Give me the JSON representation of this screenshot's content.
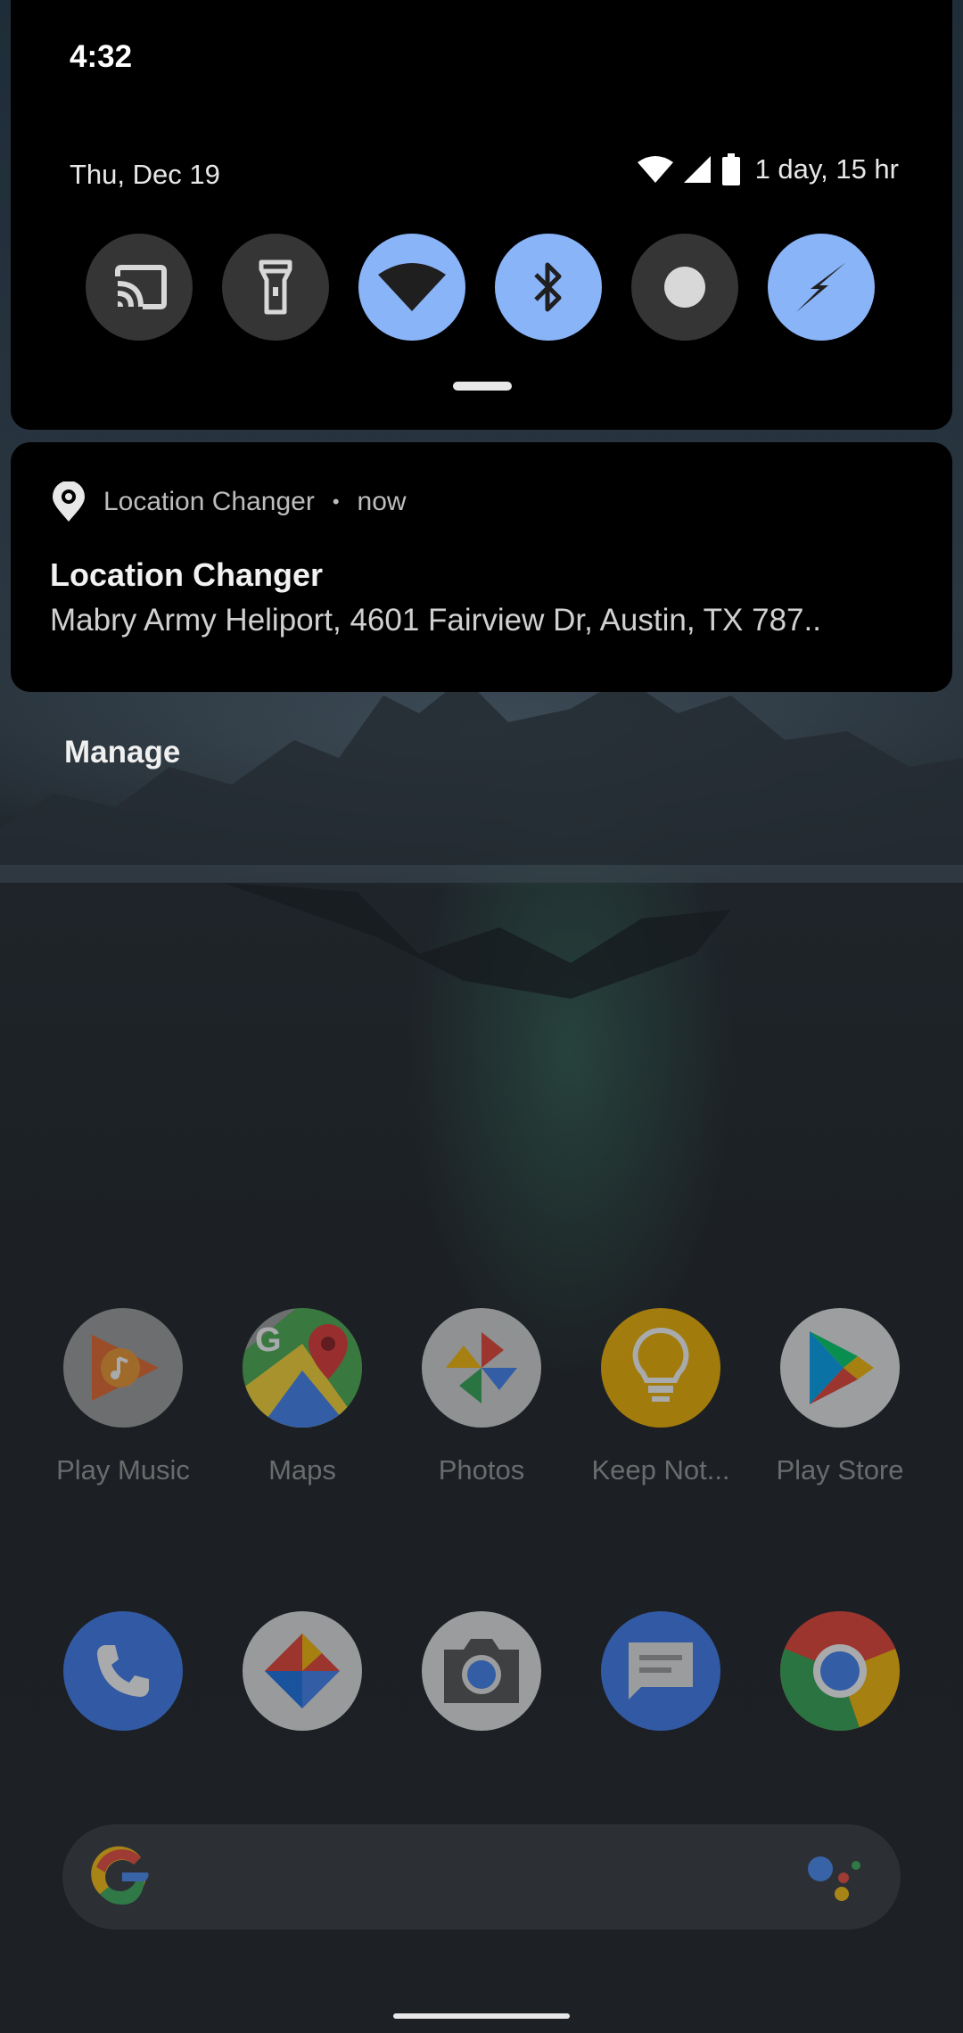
{
  "status_bar": {
    "time": "4:32",
    "date": "Thu, Dec 19",
    "battery_text": "1 day, 15 hr",
    "icons": [
      "wifi-icon",
      "cellular-signal-icon",
      "battery-icon"
    ]
  },
  "quick_settings": {
    "tiles": [
      {
        "name": "cast",
        "icon": "cast-icon",
        "active": false
      },
      {
        "name": "flashlight",
        "icon": "flashlight-icon",
        "active": false
      },
      {
        "name": "wifi",
        "icon": "wifi-icon",
        "active": true
      },
      {
        "name": "bluetooth",
        "icon": "bluetooth-icon",
        "active": true
      },
      {
        "name": "do-not-disturb",
        "icon": "dot-icon",
        "active": false
      },
      {
        "name": "battery-saver",
        "icon": "bolt-icon",
        "active": true
      }
    ],
    "colors": {
      "active": "#8ab4f8",
      "inactive": "#353535"
    }
  },
  "notification": {
    "app_name": "Location Changer",
    "separator": "•",
    "time": "now",
    "title": "Location Changer",
    "text": "Mabry Army Heliport, 4601 Fairview Dr, Austin, TX 787..",
    "icon": "location-gear-icon"
  },
  "manage_label": "Manage",
  "home": {
    "apps_row": [
      {
        "label": "Play Music",
        "icon": "play-music-icon"
      },
      {
        "label": "Maps",
        "icon": "maps-icon"
      },
      {
        "label": "Photos",
        "icon": "photos-icon"
      },
      {
        "label": "Keep Not...",
        "icon": "keep-notes-icon"
      },
      {
        "label": "Play Store",
        "icon": "play-store-icon"
      }
    ],
    "dock": [
      {
        "label": "",
        "icon": "phone-icon"
      },
      {
        "label": "",
        "icon": "duo-icon"
      },
      {
        "label": "",
        "icon": "camera-icon"
      },
      {
        "label": "",
        "icon": "messages-icon"
      },
      {
        "label": "",
        "icon": "chrome-icon"
      }
    ],
    "search_bar": {
      "logo": "google-g-icon",
      "assistant": "assistant-icon"
    }
  }
}
